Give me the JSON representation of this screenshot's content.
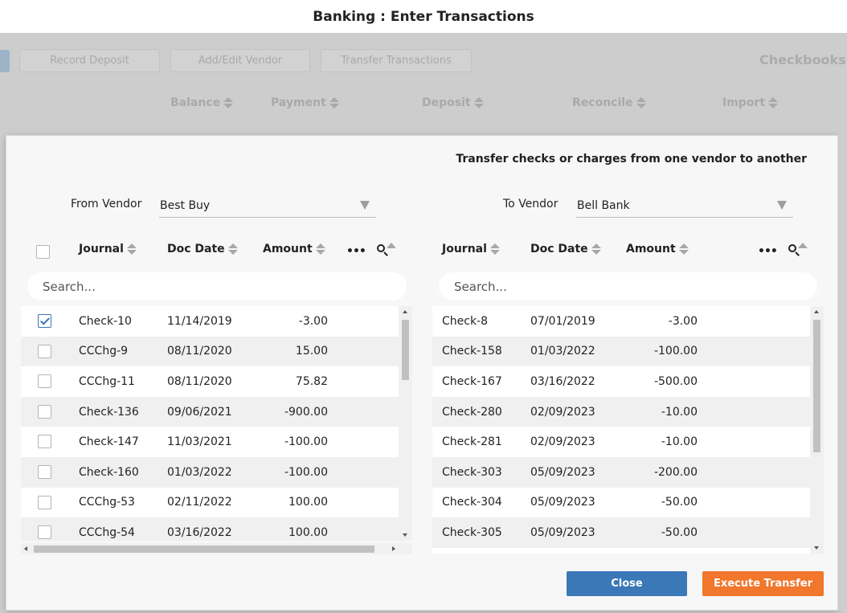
{
  "window": {
    "title": "Banking : Enter Transactions"
  },
  "background": {
    "toolbar": {
      "record_deposit": "Record Deposit",
      "add_edit_vendor": "Add/Edit Vendor",
      "transfer_transactions": "Transfer Transactions",
      "checkbooks": "Checkbooks"
    },
    "columns": [
      "Balance",
      "Payment",
      "Deposit",
      "Reconcile",
      "Import"
    ]
  },
  "modal": {
    "title": "Transfer checks or charges from one vendor to another",
    "from_vendor": {
      "label": "From Vendor",
      "value": "Best Buy"
    },
    "to_vendor": {
      "label": "To Vendor",
      "value": "Bell Bank"
    },
    "columns": {
      "journal": "Journal",
      "doc_date": "Doc Date",
      "amount": "Amount",
      "more": "•••"
    },
    "search_placeholder": "Search...",
    "left_rows": [
      {
        "journal": "Check-10",
        "doc_date": "11/14/2019",
        "amount": "-3.00",
        "checked": true
      },
      {
        "journal": "CCChg-9",
        "doc_date": "08/11/2020",
        "amount": "15.00",
        "checked": false
      },
      {
        "journal": "CCChg-11",
        "doc_date": "08/11/2020",
        "amount": "75.82",
        "checked": false
      },
      {
        "journal": "Check-136",
        "doc_date": "09/06/2021",
        "amount": "-900.00",
        "checked": false
      },
      {
        "journal": "Check-147",
        "doc_date": "11/03/2021",
        "amount": "-100.00",
        "checked": false
      },
      {
        "journal": "Check-160",
        "doc_date": "01/03/2022",
        "amount": "-100.00",
        "checked": false
      },
      {
        "journal": "CCChg-53",
        "doc_date": "02/11/2022",
        "amount": "100.00",
        "checked": false
      },
      {
        "journal": "CCChg-54",
        "doc_date": "03/16/2022",
        "amount": "100.00",
        "checked": false
      }
    ],
    "right_rows": [
      {
        "journal": "Check-8",
        "doc_date": "07/01/2019",
        "amount": "-3.00"
      },
      {
        "journal": "Check-158",
        "doc_date": "01/03/2022",
        "amount": "-100.00"
      },
      {
        "journal": "Check-167",
        "doc_date": "03/16/2022",
        "amount": "-500.00"
      },
      {
        "journal": "Check-280",
        "doc_date": "02/09/2023",
        "amount": "-10.00"
      },
      {
        "journal": "Check-281",
        "doc_date": "02/09/2023",
        "amount": "-10.00"
      },
      {
        "journal": "Check-303",
        "doc_date": "05/09/2023",
        "amount": "-200.00"
      },
      {
        "journal": "Check-304",
        "doc_date": "05/09/2023",
        "amount": "-50.00"
      },
      {
        "journal": "Check-305",
        "doc_date": "05/09/2023",
        "amount": "-50.00"
      }
    ],
    "buttons": {
      "close": "Close",
      "execute": "Execute Transfer"
    }
  },
  "colors": {
    "primary": "#3a78b8",
    "accent": "#f0772b",
    "check": "#3b73b9"
  },
  "icons": [
    "sort-icon",
    "search-icon",
    "more-icon",
    "dropdown-caret-icon",
    "checkbox-icon"
  ]
}
